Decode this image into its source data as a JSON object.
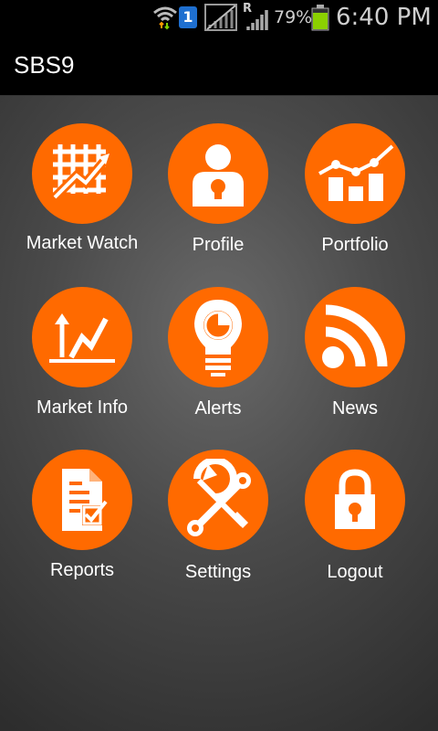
{
  "status_bar": {
    "battery_percent": "79%",
    "time": "6:40 PM",
    "roaming_indicator": "R",
    "sim_badge": "1",
    "icons": [
      "wifi-icon",
      "sim-badge-icon",
      "no-signal-icon",
      "roaming-signal-icon",
      "battery-icon"
    ]
  },
  "app_bar": {
    "title": "SBS9"
  },
  "colors": {
    "accent": "#ff6a00",
    "app_bar_bg": "#000000",
    "label_text": "#ffffff",
    "battery": "#8bd000"
  },
  "menu": [
    {
      "label": "Market Watch",
      "icon": "market-watch-icon"
    },
    {
      "label": "Profile",
      "icon": "profile-icon"
    },
    {
      "label": "Portfolio",
      "icon": "portfolio-icon"
    },
    {
      "label": "Market Info",
      "icon": "market-info-icon"
    },
    {
      "label": "Alerts",
      "icon": "alerts-icon"
    },
    {
      "label": "News",
      "icon": "news-icon"
    },
    {
      "label": "Reports",
      "icon": "reports-icon"
    },
    {
      "label": "Settings",
      "icon": "settings-icon"
    },
    {
      "label": "Logout",
      "icon": "logout-icon"
    }
  ]
}
